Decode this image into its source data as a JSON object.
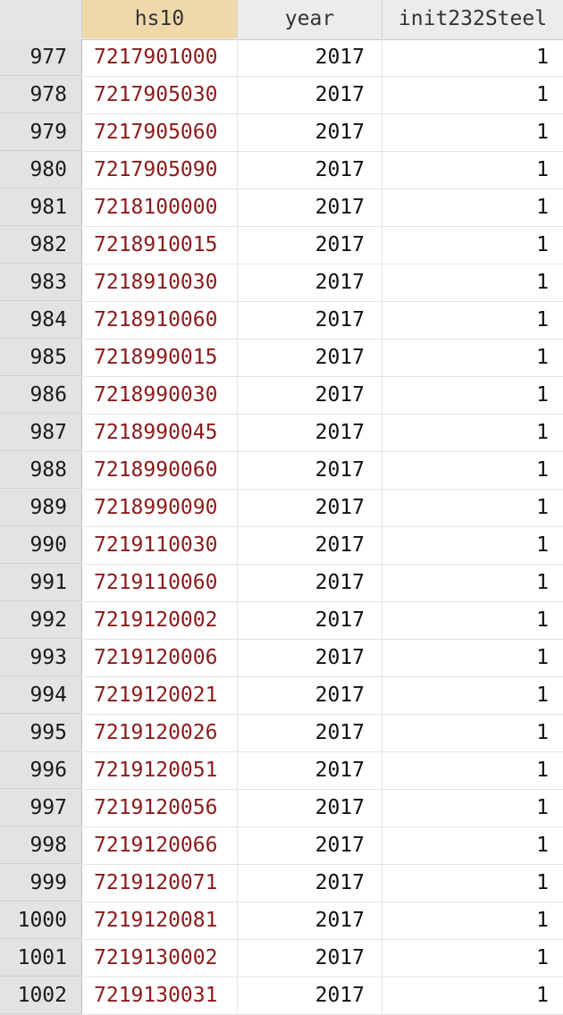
{
  "columns": {
    "hs10": "hs10",
    "year": "year",
    "init232Steel": "init232Steel"
  },
  "selected_column": "hs10",
  "colors": {
    "selected_header": "#efd9ab",
    "string_value": "#8b1a1a",
    "row_header_bg": "#e3e3e3"
  },
  "rows": [
    {
      "n": "977",
      "hs10": "7217901000",
      "year": "2017",
      "init232Steel": "1"
    },
    {
      "n": "978",
      "hs10": "7217905030",
      "year": "2017",
      "init232Steel": "1"
    },
    {
      "n": "979",
      "hs10": "7217905060",
      "year": "2017",
      "init232Steel": "1"
    },
    {
      "n": "980",
      "hs10": "7217905090",
      "year": "2017",
      "init232Steel": "1"
    },
    {
      "n": "981",
      "hs10": "7218100000",
      "year": "2017",
      "init232Steel": "1"
    },
    {
      "n": "982",
      "hs10": "7218910015",
      "year": "2017",
      "init232Steel": "1"
    },
    {
      "n": "983",
      "hs10": "7218910030",
      "year": "2017",
      "init232Steel": "1"
    },
    {
      "n": "984",
      "hs10": "7218910060",
      "year": "2017",
      "init232Steel": "1"
    },
    {
      "n": "985",
      "hs10": "7218990015",
      "year": "2017",
      "init232Steel": "1"
    },
    {
      "n": "986",
      "hs10": "7218990030",
      "year": "2017",
      "init232Steel": "1"
    },
    {
      "n": "987",
      "hs10": "7218990045",
      "year": "2017",
      "init232Steel": "1"
    },
    {
      "n": "988",
      "hs10": "7218990060",
      "year": "2017",
      "init232Steel": "1"
    },
    {
      "n": "989",
      "hs10": "7218990090",
      "year": "2017",
      "init232Steel": "1"
    },
    {
      "n": "990",
      "hs10": "7219110030",
      "year": "2017",
      "init232Steel": "1"
    },
    {
      "n": "991",
      "hs10": "7219110060",
      "year": "2017",
      "init232Steel": "1"
    },
    {
      "n": "992",
      "hs10": "7219120002",
      "year": "2017",
      "init232Steel": "1"
    },
    {
      "n": "993",
      "hs10": "7219120006",
      "year": "2017",
      "init232Steel": "1"
    },
    {
      "n": "994",
      "hs10": "7219120021",
      "year": "2017",
      "init232Steel": "1"
    },
    {
      "n": "995",
      "hs10": "7219120026",
      "year": "2017",
      "init232Steel": "1"
    },
    {
      "n": "996",
      "hs10": "7219120051",
      "year": "2017",
      "init232Steel": "1"
    },
    {
      "n": "997",
      "hs10": "7219120056",
      "year": "2017",
      "init232Steel": "1"
    },
    {
      "n": "998",
      "hs10": "7219120066",
      "year": "2017",
      "init232Steel": "1"
    },
    {
      "n": "999",
      "hs10": "7219120071",
      "year": "2017",
      "init232Steel": "1"
    },
    {
      "n": "1000",
      "hs10": "7219120081",
      "year": "2017",
      "init232Steel": "1"
    },
    {
      "n": "1001",
      "hs10": "7219130002",
      "year": "2017",
      "init232Steel": "1"
    },
    {
      "n": "1002",
      "hs10": "7219130031",
      "year": "2017",
      "init232Steel": "1"
    }
  ]
}
